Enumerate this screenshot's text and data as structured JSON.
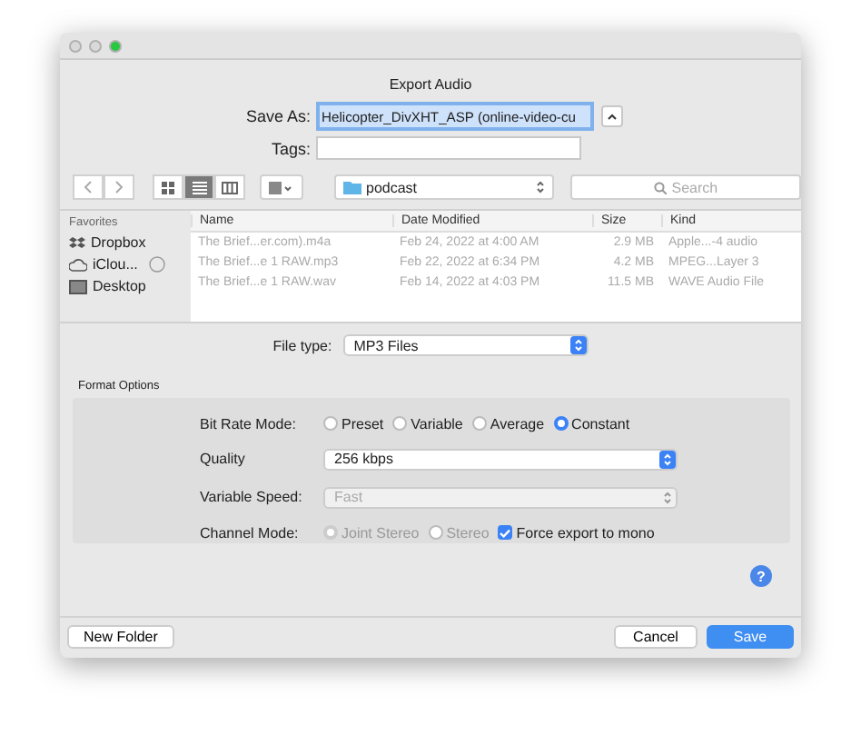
{
  "window": {
    "title": "Export Audio",
    "traffic_lights": [
      {
        "color": "#d9d9d9"
      },
      {
        "color": "#d9d9d9"
      },
      {
        "color": "#28c840"
      }
    ]
  },
  "save_as": {
    "label": "Save As:",
    "value": "Helicopter_DivXHT_ASP (online-video-cu"
  },
  "tags": {
    "label": "Tags:"
  },
  "toolbar": {
    "views": [
      {
        "kind": "icons",
        "selected": false
      },
      {
        "kind": "list",
        "selected": true
      },
      {
        "kind": "columns",
        "selected": false
      }
    ],
    "location": "podcast",
    "search": {
      "placeholder": "Search"
    }
  },
  "sidebar": {
    "heading": "Favorites",
    "items": [
      {
        "kind": "dropbox",
        "label": "Dropbox",
        "syncing": false
      },
      {
        "kind": "cloud",
        "label": "iClou...",
        "syncing": true
      },
      {
        "kind": "desktop",
        "label": "Desktop",
        "syncing": false
      }
    ]
  },
  "table": {
    "columns": [
      "Name",
      "Date Modified",
      "Size",
      "Kind"
    ],
    "rows": [
      {
        "name": "The Brief...er.com).m4a",
        "date": "Feb 24, 2022 at 4:00 AM",
        "size": "2.9 MB",
        "kind": "Apple...-4 audio"
      },
      {
        "name": "The Brief...e 1 RAW.mp3",
        "date": "Feb 22, 2022 at 6:34 PM",
        "size": "4.2 MB",
        "kind": "MPEG...Layer 3"
      },
      {
        "name": "The Brief...e 1 RAW.wav",
        "date": "Feb 14, 2022 at 4:03 PM",
        "size": "11.5 MB",
        "kind": "WAVE Audio File"
      }
    ]
  },
  "file_type": {
    "label": "File type:",
    "value": "MP3 Files"
  },
  "format_options": {
    "title": "Format Options",
    "bit_rate_mode": {
      "label": "Bit Rate Mode:",
      "options": [
        {
          "label": "Preset",
          "selected": false
        },
        {
          "label": "Variable",
          "selected": false
        },
        {
          "label": "Average",
          "selected": false
        },
        {
          "label": "Constant",
          "selected": true
        }
      ]
    },
    "quality": {
      "label": "Quality",
      "value": "256 kbps",
      "disabled": false
    },
    "variable_speed": {
      "label": "Variable Speed:",
      "value": "Fast",
      "disabled": true
    },
    "channel_mode": {
      "label": "Channel Mode:",
      "options": [
        {
          "label": "Joint Stereo",
          "selected": true,
          "disabled": true
        },
        {
          "label": "Stereo",
          "selected": false,
          "disabled": true
        }
      ],
      "force_mono": {
        "label": "Force export to mono",
        "checked": true
      }
    }
  },
  "buttons": {
    "new_folder": "New Folder",
    "cancel": "Cancel",
    "save": "Save",
    "help": "?"
  }
}
